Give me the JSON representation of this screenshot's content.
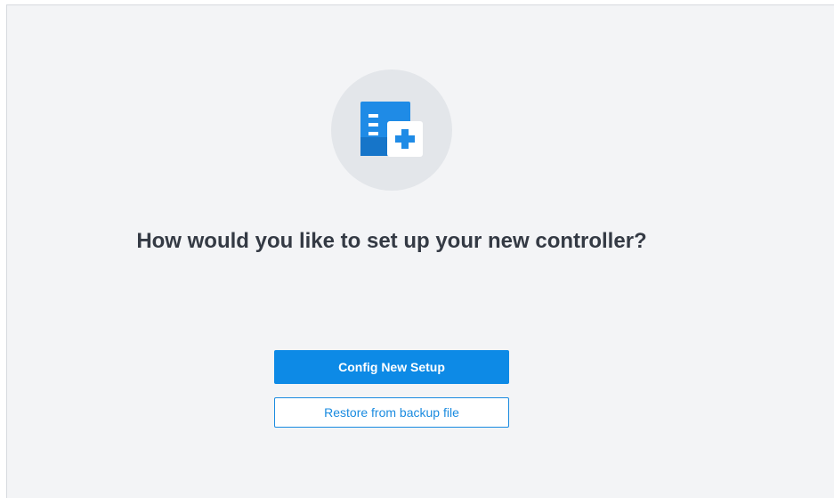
{
  "setup": {
    "icon": "document-add-icon",
    "heading": "How would you like to set up your new controller?",
    "primary_button_label": "Config New Setup",
    "secondary_button_label": "Restore from backup file"
  },
  "colors": {
    "accent": "#0d8ae6",
    "background": "#f3f4f6",
    "text": "#343a44"
  }
}
